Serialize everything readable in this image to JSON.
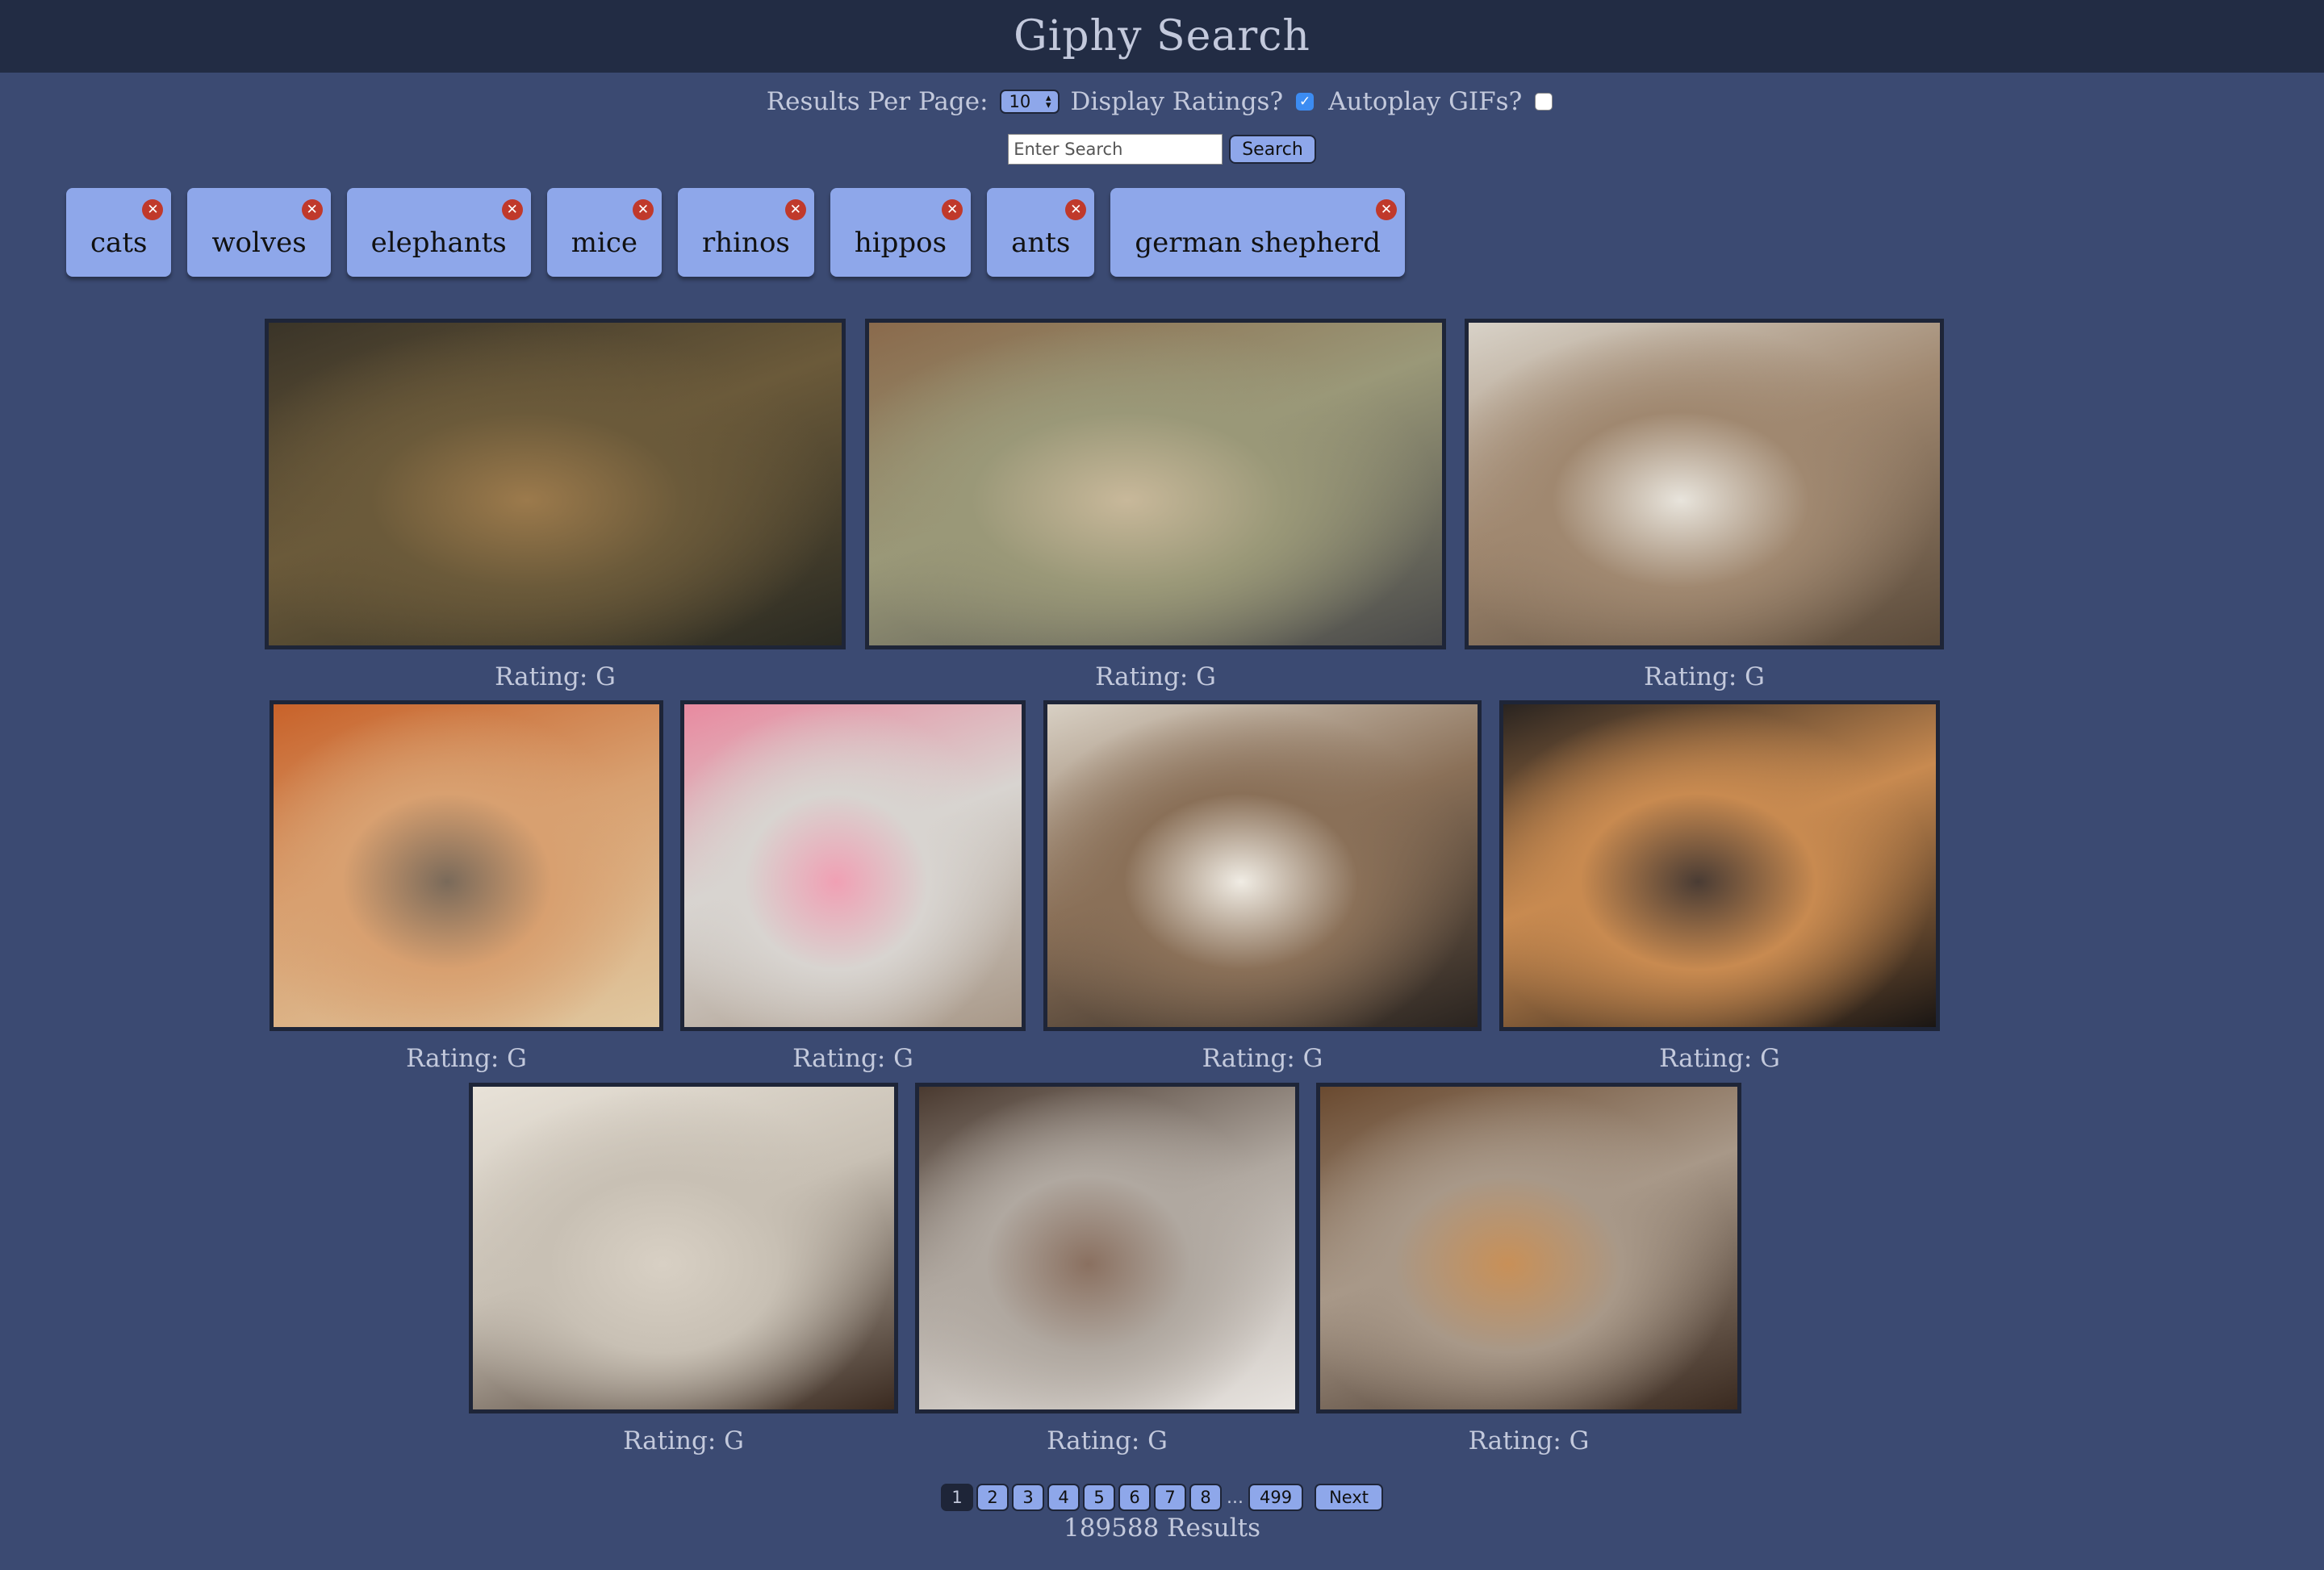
{
  "header": {
    "title": "Giphy Search"
  },
  "options": {
    "results_per_page_label": "Results Per Page:",
    "results_per_page_value": "10",
    "display_ratings_label": "Display Ratings?",
    "display_ratings_checked": true,
    "autoplay_label": "Autoplay GIFs?",
    "autoplay_checked": false
  },
  "search": {
    "placeholder": "Enter Search",
    "button_label": "Search"
  },
  "chips": [
    {
      "label": "cats"
    },
    {
      "label": "wolves"
    },
    {
      "label": "elephants"
    },
    {
      "label": "mice"
    },
    {
      "label": "rhinos"
    },
    {
      "label": "hippos"
    },
    {
      "label": "ants"
    },
    {
      "label": "german shepherd"
    }
  ],
  "gifs": [
    {
      "rating": "Rating: G",
      "palette": [
        "#3a3428",
        "#6b5a3a",
        "#9c7a4c",
        "#2a2a22"
      ]
    },
    {
      "rating": "Rating: G",
      "palette": [
        "#8a6a4c",
        "#9a9878",
        "#c8b89a",
        "#4a4a4a"
      ]
    },
    {
      "rating": "Rating: G",
      "palette": [
        "#d8d2c8",
        "#a08870",
        "#e8e4dc",
        "#5a4a3a"
      ]
    },
    {
      "rating": "Rating: G",
      "palette": [
        "#c8622a",
        "#d8a070",
        "#7a6a5a",
        "#e0c8a0"
      ]
    },
    {
      "rating": "Rating: G",
      "palette": [
        "#e88aa0",
        "#d8d4d0",
        "#f0a0b4",
        "#a89888"
      ]
    },
    {
      "rating": "Rating: G",
      "palette": [
        "#d8d0c4",
        "#8a7058",
        "#f0ece4",
        "#2a2420"
      ]
    },
    {
      "rating": "Rating: G",
      "palette": [
        "#2a2420",
        "#c88a50",
        "#4a3c34",
        "#1a1614"
      ]
    },
    {
      "rating": "Rating: G",
      "palette": [
        "#e8e2d8",
        "#c8c0b4",
        "#d8d0c4",
        "#3a2a20"
      ]
    },
    {
      "rating": "Rating: G",
      "palette": [
        "#4a3a30",
        "#b0a8a0",
        "#8a7060",
        "#e8e4e0"
      ]
    },
    {
      "rating": "Rating: G",
      "palette": [
        "#6a4a30",
        "#a89888",
        "#c89058",
        "#3a2a20"
      ]
    }
  ],
  "pagination": {
    "pages": [
      "1",
      "2",
      "3",
      "4",
      "5",
      "6",
      "7",
      "8"
    ],
    "ellipsis": "...",
    "last": "499",
    "next_label": "Next",
    "active_page": "1"
  },
  "results_text": "189588 Results"
}
